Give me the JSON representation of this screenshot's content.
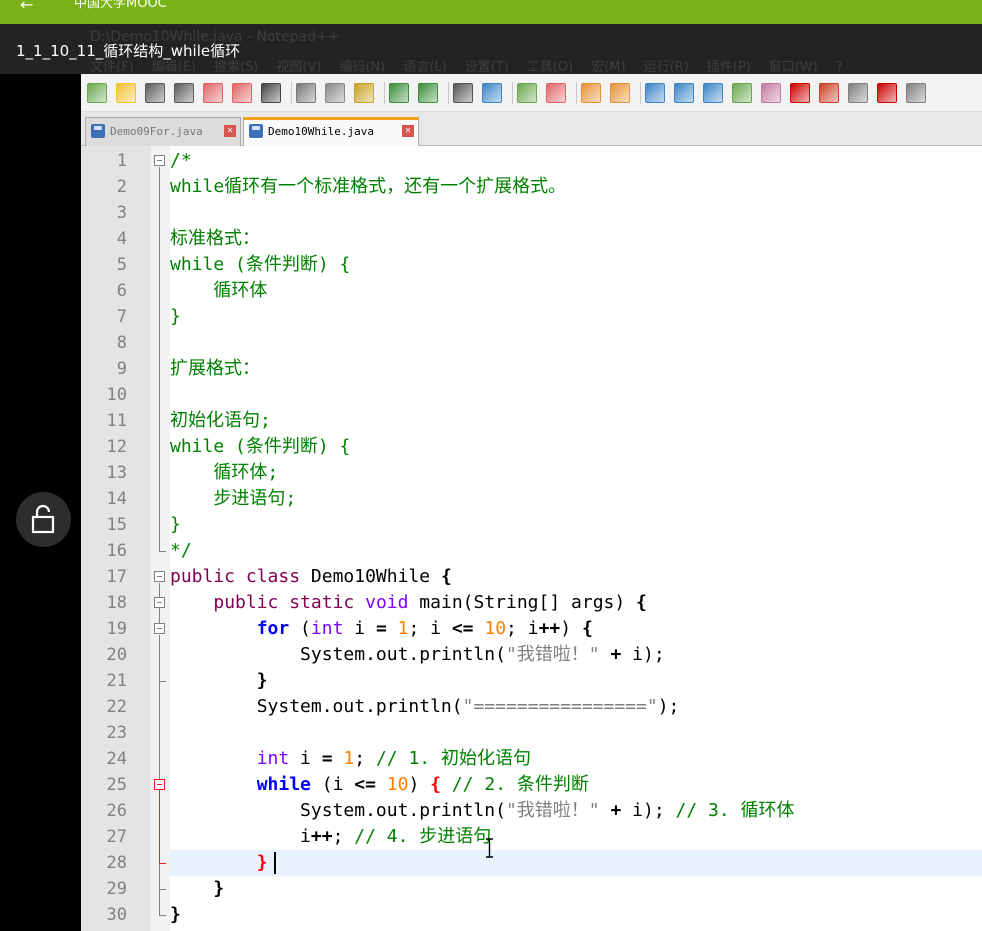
{
  "mooc": {
    "back_icon": "arrow-left-icon",
    "title": "中国大学MOOC"
  },
  "video": {
    "title": "1_1_10_11_循环结构_while循环",
    "ghost_window_title": "D:\\Demo10While.java - Notepad++",
    "ghost_menu": [
      "文件(F)",
      "编辑(E)",
      "搜索(S)",
      "视图(V)",
      "编码(N)",
      "语言(L)",
      "设置(T)",
      "工具(O)",
      "宏(M)",
      "运行(R)",
      "插件(P)",
      "窗口(W)",
      "?"
    ]
  },
  "lock": {
    "icon": "lock-icon"
  },
  "tabs": [
    {
      "label": "Demo09For.java",
      "active": false
    },
    {
      "label": "Demo10While.java",
      "active": true
    }
  ],
  "editor": {
    "line_numbers": [
      "1",
      "2",
      "3",
      "4",
      "5",
      "6",
      "7",
      "8",
      "9",
      "10",
      "11",
      "12",
      "13",
      "14",
      "15",
      "16",
      "17",
      "18",
      "19",
      "20",
      "21",
      "22",
      "23",
      "24",
      "25",
      "26",
      "27",
      "28",
      "29",
      "30"
    ],
    "current_line": 28,
    "lines": [
      [
        [
          "c",
          "/*"
        ]
      ],
      [
        [
          "c",
          "while循环有一个标准格式，还有一个扩展格式。"
        ]
      ],
      [],
      [
        [
          "c",
          "标准格式："
        ]
      ],
      [
        [
          "c",
          "while (条件判断) {"
        ]
      ],
      [
        [
          "c",
          "    循环体"
        ]
      ],
      [
        [
          "c",
          "}"
        ]
      ],
      [],
      [
        [
          "c",
          "扩展格式："
        ]
      ],
      [],
      [
        [
          "c",
          "初始化语句;"
        ]
      ],
      [
        [
          "c",
          "while (条件判断) {"
        ]
      ],
      [
        [
          "c",
          "    循环体;"
        ]
      ],
      [
        [
          "c",
          "    步进语句;"
        ]
      ],
      [
        [
          "c",
          "}"
        ]
      ],
      [
        [
          "c",
          "*/"
        ]
      ],
      [
        [
          "k",
          "public"
        ],
        [
          "p",
          " "
        ],
        [
          "k",
          "class"
        ],
        [
          "p",
          " Demo10While "
        ],
        [
          "b",
          "{"
        ]
      ],
      [
        [
          "p",
          "    "
        ],
        [
          "k",
          "public"
        ],
        [
          "p",
          " "
        ],
        [
          "k",
          "static"
        ],
        [
          "p",
          " "
        ],
        [
          "t",
          "void"
        ],
        [
          "p",
          " main(String[] args) "
        ],
        [
          "b",
          "{"
        ]
      ],
      [
        [
          "p",
          "        "
        ],
        [
          "kb",
          "for"
        ],
        [
          "p",
          " ("
        ],
        [
          "t",
          "int"
        ],
        [
          "p",
          " i "
        ],
        [
          "b",
          "="
        ],
        [
          "p",
          " "
        ],
        [
          "n",
          "1"
        ],
        [
          "p",
          "; i "
        ],
        [
          "b",
          "<="
        ],
        [
          "p",
          " "
        ],
        [
          "n",
          "10"
        ],
        [
          "p",
          "; i"
        ],
        [
          "b",
          "++"
        ],
        [
          "p",
          ") "
        ],
        [
          "b",
          "{"
        ]
      ],
      [
        [
          "p",
          "            System.out.println("
        ],
        [
          "s",
          "\"我错啦！\""
        ],
        [
          "p",
          " "
        ],
        [
          "b",
          "+"
        ],
        [
          "p",
          " i);"
        ]
      ],
      [
        [
          "p",
          "        "
        ],
        [
          "b",
          "}"
        ]
      ],
      [
        [
          "p",
          "        System.out.println("
        ],
        [
          "s",
          "\"================\""
        ],
        [
          "p",
          ");"
        ]
      ],
      [],
      [
        [
          "p",
          "        "
        ],
        [
          "t",
          "int"
        ],
        [
          "p",
          " i "
        ],
        [
          "b",
          "="
        ],
        [
          "p",
          " "
        ],
        [
          "n",
          "1"
        ],
        [
          "p",
          "; "
        ],
        [
          "c",
          "// 1. 初始化语句"
        ]
      ],
      [
        [
          "p",
          "        "
        ],
        [
          "kb",
          "while"
        ],
        [
          "p",
          " (i "
        ],
        [
          "b",
          "<="
        ],
        [
          "p",
          " "
        ],
        [
          "n",
          "10"
        ],
        [
          "p",
          ") "
        ],
        [
          "red",
          "{"
        ],
        [
          "p",
          " "
        ],
        [
          "c",
          "// 2. 条件判断"
        ]
      ],
      [
        [
          "p",
          "            System.out.println("
        ],
        [
          "s",
          "\"我错啦！\""
        ],
        [
          "p",
          " "
        ],
        [
          "b",
          "+"
        ],
        [
          "p",
          " i); "
        ],
        [
          "c",
          "// 3. 循环体"
        ]
      ],
      [
        [
          "p",
          "            i"
        ],
        [
          "b",
          "++"
        ],
        [
          "p",
          "; "
        ],
        [
          "c",
          "// 4. 步进语句"
        ]
      ],
      [
        [
          "p",
          "        "
        ],
        [
          "red",
          "}"
        ]
      ],
      [
        [
          "p",
          "    "
        ],
        [
          "b",
          "}"
        ]
      ],
      [
        [
          "b",
          "}"
        ]
      ]
    ]
  },
  "colors": {
    "mooc_green": "#7ab317",
    "comment": "#008000",
    "keyword": "#7f0055",
    "flow_keyword": "#0000ff",
    "type": "#8000ff",
    "number": "#ff8000",
    "string": "#808080",
    "brace_match": "#ff0000",
    "caret_line": "#e8f2ff"
  }
}
